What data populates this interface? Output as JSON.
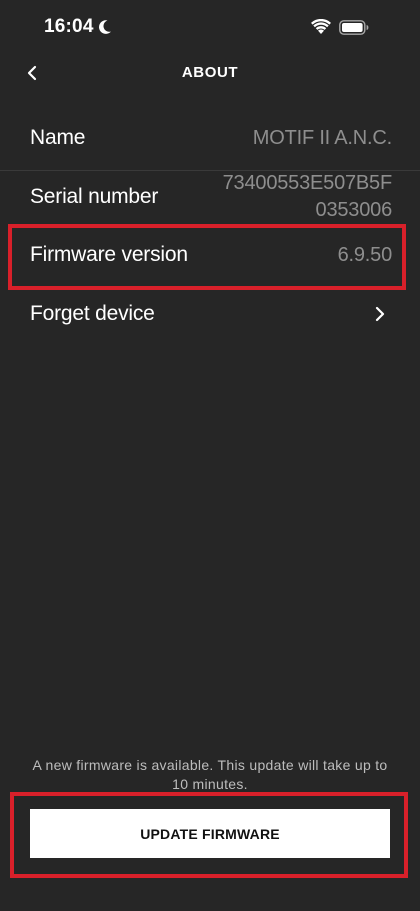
{
  "status_bar": {
    "time": "16:04",
    "moon_icon": "moon-icon",
    "wifi_icon": "wifi-icon",
    "battery_icon": "battery-icon"
  },
  "header": {
    "back_icon": "chevron-left-icon",
    "title": "ABOUT"
  },
  "rows": {
    "name": {
      "label": "Name",
      "value": "MOTIF II A.N.C."
    },
    "serial": {
      "label": "Serial number",
      "value_line1": "73400553E507B5F",
      "value_line2": "0353006"
    },
    "firmware": {
      "label": "Firmware version",
      "value": "6.9.50"
    },
    "forget": {
      "label": "Forget device",
      "icon": "chevron-right-icon"
    }
  },
  "footer": {
    "note": "A new firmware is available. This update will take up to 10 minutes.",
    "button_label": "UPDATE FIRMWARE"
  },
  "colors": {
    "background": "#262626",
    "highlight": "#d8202a",
    "secondary_text": "#8e8e8e",
    "button_bg": "#ffffff"
  }
}
